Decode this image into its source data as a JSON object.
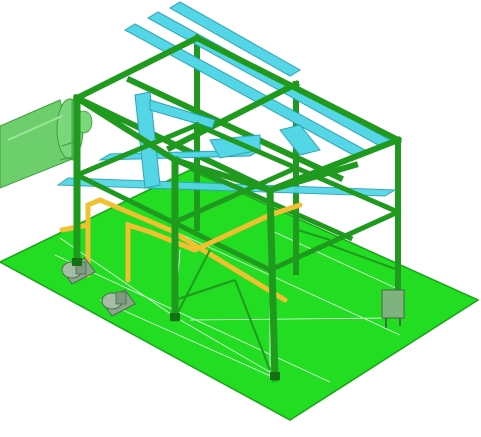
{
  "viewport": {
    "background": "#ffffff"
  },
  "colors": {
    "ground": "#22dd22",
    "ground_edge": "#18a318",
    "steel": "#1f9a1f",
    "steel_dark": "#137013",
    "cyan_duct": "#55d6e6",
    "cyan_dark": "#2aa6b8",
    "vessel": "#6ccf6c",
    "vessel_dark": "#3e9b3e",
    "pipe": "#f0c030",
    "pipe_dark": "#c89410",
    "pump": "#8aa58a",
    "white_line": "#ffffff"
  },
  "model": {
    "components": [
      "ground-slab",
      "steel-frame",
      "cable-tray-top",
      "cable-tray-mid",
      "horizontal-vessel",
      "process-pipes",
      "pump-1",
      "pump-2",
      "control-panel"
    ]
  }
}
